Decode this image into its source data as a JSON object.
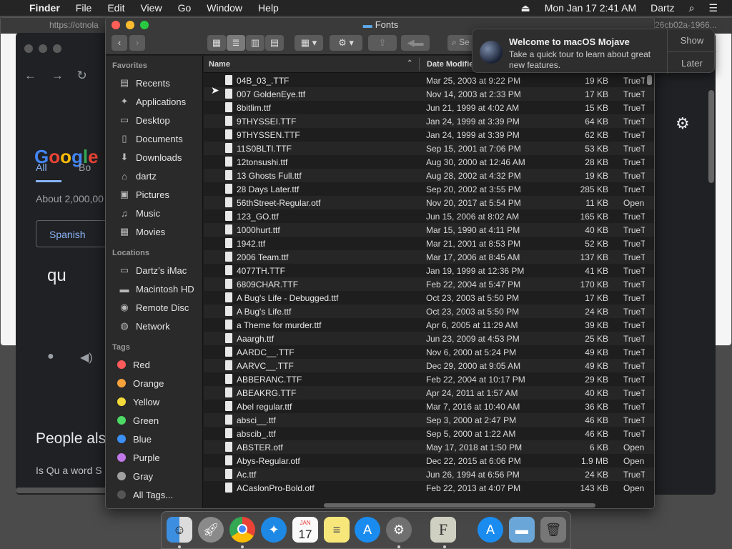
{
  "menubar": {
    "app": "Finder",
    "items": [
      "File",
      "Edit",
      "View",
      "Go",
      "Window",
      "Help"
    ],
    "clock": "Mon Jan 17  2:41 AM",
    "user": "Dartz"
  },
  "background": {
    "chrome_url_left": "https://otnola",
    "chrome_url_right": "26cb02a-1966...",
    "google": {
      "logo": "Google",
      "tab_all": "All",
      "tab_books": "Bo",
      "results": "About 2,000,00",
      "translate_lang": "Spanish",
      "query": "qu",
      "people_also": "People als",
      "question": "Is Qu a word S"
    }
  },
  "finder": {
    "title": "Fonts",
    "search_placeholder": "Se",
    "sidebar": {
      "favorites_label": "Favorites",
      "favorites": [
        {
          "label": "Recents",
          "icon": "recents-icon"
        },
        {
          "label": "Applications",
          "icon": "applications-icon"
        },
        {
          "label": "Desktop",
          "icon": "desktop-icon"
        },
        {
          "label": "Documents",
          "icon": "documents-icon"
        },
        {
          "label": "Downloads",
          "icon": "downloads-icon"
        },
        {
          "label": "dartz",
          "icon": "home-icon"
        },
        {
          "label": "Pictures",
          "icon": "pictures-icon"
        },
        {
          "label": "Music",
          "icon": "music-icon"
        },
        {
          "label": "Movies",
          "icon": "movies-icon"
        }
      ],
      "locations_label": "Locations",
      "locations": [
        {
          "label": "Dartz’s iMac",
          "icon": "imac-icon"
        },
        {
          "label": "Macintosh HD",
          "icon": "harddisk-icon"
        },
        {
          "label": "Remote Disc",
          "icon": "disc-icon"
        },
        {
          "label": "Network",
          "icon": "network-icon"
        }
      ],
      "tags_label": "Tags",
      "tags": [
        {
          "label": "Red",
          "color": "#ff5b5b"
        },
        {
          "label": "Orange",
          "color": "#f6a33b"
        },
        {
          "label": "Yellow",
          "color": "#f4d93a"
        },
        {
          "label": "Green",
          "color": "#4cd964"
        },
        {
          "label": "Blue",
          "color": "#3b8ff6"
        },
        {
          "label": "Purple",
          "color": "#c178e8"
        },
        {
          "label": "Gray",
          "color": "#a0a0a0"
        },
        {
          "label": "All Tags...",
          "color": "#555555"
        }
      ]
    },
    "columns": {
      "name": "Name",
      "date": "Date Modifie"
    },
    "files": [
      {
        "name": "04B_03_.TTF",
        "date": "Mar 25, 2003 at 9:22 PM",
        "size": "19 KB",
        "kind": "TrueT"
      },
      {
        "name": "007 GoldenEye.ttf",
        "date": "Nov 14, 2003 at 2:33 PM",
        "size": "17 KB",
        "kind": "TrueT"
      },
      {
        "name": "8bitlim.ttf",
        "date": "Jun 21, 1999 at 4:02 AM",
        "size": "15 KB",
        "kind": "TrueT"
      },
      {
        "name": "9THYSSEI.TTF",
        "date": "Jan 24, 1999 at 3:39 PM",
        "size": "64 KB",
        "kind": "TrueT"
      },
      {
        "name": "9THYSSEN.TTF",
        "date": "Jan 24, 1999 at 3:39 PM",
        "size": "62 KB",
        "kind": "TrueT"
      },
      {
        "name": "11S0BLTI.TTF",
        "date": "Sep 15, 2001 at 7:06 PM",
        "size": "53 KB",
        "kind": "TrueT"
      },
      {
        "name": "12tonsushi.ttf",
        "date": "Aug 30, 2000 at 12:46 AM",
        "size": "28 KB",
        "kind": "TrueT"
      },
      {
        "name": "13 Ghosts Full.ttf",
        "date": "Aug 28, 2002 at 4:32 PM",
        "size": "19 KB",
        "kind": "TrueT"
      },
      {
        "name": "28 Days Later.ttf",
        "date": "Sep 20, 2002 at 3:55 PM",
        "size": "285 KB",
        "kind": "TrueT"
      },
      {
        "name": "56thStreet-Regular.otf",
        "date": "Nov 20, 2017 at 5:54 PM",
        "size": "11 KB",
        "kind": "Open"
      },
      {
        "name": "123_GO.ttf",
        "date": "Jun 15, 2006 at 8:02 AM",
        "size": "165 KB",
        "kind": "TrueT"
      },
      {
        "name": "1000hurt.ttf",
        "date": "Mar 15, 1990 at 4:11 PM",
        "size": "40 KB",
        "kind": "TrueT"
      },
      {
        "name": "1942.ttf",
        "date": "Mar 21, 2001 at 8:53 PM",
        "size": "52 KB",
        "kind": "TrueT"
      },
      {
        "name": "2006 Team.ttf",
        "date": "Mar 17, 2006 at 8:45 AM",
        "size": "137 KB",
        "kind": "TrueT"
      },
      {
        "name": "4077TH.TTF",
        "date": "Jan 19, 1999 at 12:36 PM",
        "size": "41 KB",
        "kind": "TrueT"
      },
      {
        "name": "6809CHAR.TTF",
        "date": "Feb 22, 2004 at 5:47 PM",
        "size": "170 KB",
        "kind": "TrueT"
      },
      {
        "name": "A Bug's Life - Debugged.ttf",
        "date": "Oct 23, 2003 at 5:50 PM",
        "size": "17 KB",
        "kind": "TrueT"
      },
      {
        "name": "A Bug's Life.ttf",
        "date": "Oct 23, 2003 at 5:50 PM",
        "size": "24 KB",
        "kind": "TrueT"
      },
      {
        "name": "a Theme for murder.ttf",
        "date": "Apr 6, 2005 at 11:29 AM",
        "size": "39 KB",
        "kind": "TrueT"
      },
      {
        "name": "Aaargh.ttf",
        "date": "Jun 23, 2009 at 4:53 PM",
        "size": "25 KB",
        "kind": "TrueT"
      },
      {
        "name": "AARDC__.TTF",
        "date": "Nov 6, 2000 at 5:24 PM",
        "size": "49 KB",
        "kind": "TrueT"
      },
      {
        "name": "AARVC__.TTF",
        "date": "Dec 29, 2000 at 9:05 AM",
        "size": "49 KB",
        "kind": "TrueT"
      },
      {
        "name": "ABBERANC.TTF",
        "date": "Feb 22, 2004 at 10:17 PM",
        "size": "29 KB",
        "kind": "TrueT"
      },
      {
        "name": "ABEAKRG.TTF",
        "date": "Apr 24, 2011 at 1:57 AM",
        "size": "40 KB",
        "kind": "TrueT"
      },
      {
        "name": "Abel regular.ttf",
        "date": "Mar 7, 2016 at 10:40 AM",
        "size": "36 KB",
        "kind": "TrueT"
      },
      {
        "name": "absci__.ttf",
        "date": "Sep 3, 2000 at 2:47 PM",
        "size": "46 KB",
        "kind": "TrueT"
      },
      {
        "name": "abscib_.ttf",
        "date": "Sep 5, 2000 at 1:22 AM",
        "size": "46 KB",
        "kind": "TrueT"
      },
      {
        "name": "ABSTER.otf",
        "date": "May 17, 2018 at 1:50 PM",
        "size": "6 KB",
        "kind": "Open"
      },
      {
        "name": "Abys-Regular.otf",
        "date": "Dec 22, 2015 at 6:06 PM",
        "size": "1.9 MB",
        "kind": "Open"
      },
      {
        "name": "Ac.ttf",
        "date": "Jun 26, 1994 at 6:56 PM",
        "size": "24 KB",
        "kind": "TrueT"
      },
      {
        "name": "ACaslonPro-Bold.otf",
        "date": "Feb 22, 2013 at 4:07 PM",
        "size": "143 KB",
        "kind": "Open"
      }
    ]
  },
  "notification": {
    "title": "Welcome to macOS Mojave",
    "body": "Take a quick tour to learn about great new features.",
    "show": "Show",
    "later": "Later"
  },
  "dock": {
    "calendar_month": "JAN",
    "calendar_day": "17",
    "fontbook_letter": "F",
    "items": [
      "finder-icon",
      "launchpad-icon",
      "chrome-icon",
      "safari-icon",
      "calendar-icon",
      "notes-icon",
      "app-store-icon",
      "system-preferences-icon",
      "font-book-icon",
      "app-store-downloads-icon",
      "applications-folder-icon",
      "trash-icon"
    ]
  }
}
